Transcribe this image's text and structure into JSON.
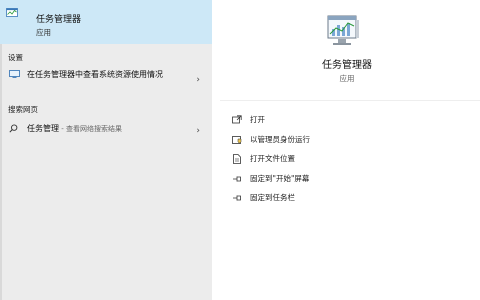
{
  "best_match": {
    "title": "任务管理器",
    "subtitle": "应用"
  },
  "settings": {
    "label": "设置",
    "item": "在任务管理器中查看系统资源使用情况"
  },
  "web": {
    "label": "搜索网页",
    "term": "任务管理",
    "suffix": " - 查看网络搜索结果"
  },
  "preview": {
    "title": "任务管理器",
    "subtitle": "应用"
  },
  "actions": [
    {
      "label": "打开",
      "icon": "open-icon"
    },
    {
      "label": "以管理员身份运行",
      "icon": "shield-run-icon"
    },
    {
      "label": "打开文件位置",
      "icon": "file-location-icon"
    },
    {
      "label": "固定到\"开始\"屏幕",
      "icon": "pin-icon"
    },
    {
      "label": "固定到任务栏",
      "icon": "pin-icon"
    }
  ],
  "colors": {
    "selected": "#cde8f7",
    "left_bg": "#ececec",
    "accent": "#0078d7"
  }
}
